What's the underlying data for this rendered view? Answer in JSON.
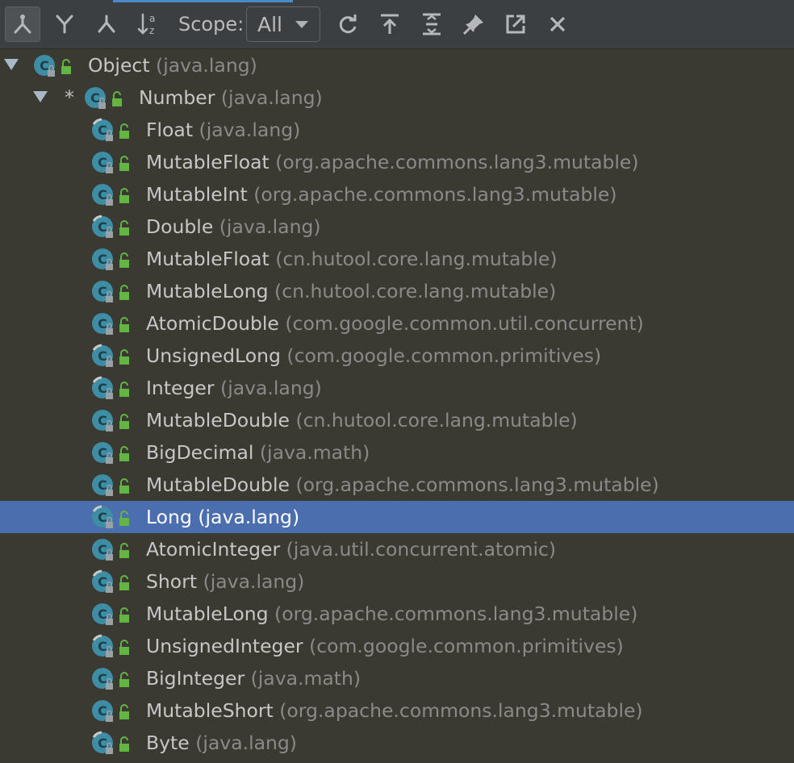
{
  "toolbar": {
    "buttons": [
      {
        "icon": "supertypes-hierarchy-icon",
        "active": true
      },
      {
        "icon": "subtypes-hierarchy-icon",
        "active": false
      },
      {
        "icon": "class-hierarchy-icon",
        "active": false
      },
      {
        "icon": "sort-alphabetically-icon",
        "active": false
      }
    ],
    "scope_label": "Scope:",
    "scope_value": "All",
    "right_buttons": [
      "refresh-icon",
      "export-icon",
      "expand-all-icon",
      "pin-icon",
      "open-in-window-icon",
      "close-icon"
    ]
  },
  "tree": {
    "rows": [
      {
        "name": "Object",
        "pkg": "(java.lang)",
        "level": 0,
        "expanded": true
      },
      {
        "name": "Number",
        "pkg": "(java.lang)",
        "level": 1,
        "expanded": true,
        "star": "*"
      },
      {
        "name": "Float",
        "pkg": "(java.lang)",
        "level": 2,
        "final": true
      },
      {
        "name": "MutableFloat",
        "pkg": "(org.apache.commons.lang3.mutable)",
        "level": 2
      },
      {
        "name": "MutableInt",
        "pkg": "(org.apache.commons.lang3.mutable)",
        "level": 2
      },
      {
        "name": "Double",
        "pkg": "(java.lang)",
        "level": 2,
        "final": true
      },
      {
        "name": "MutableFloat",
        "pkg": "(cn.hutool.core.lang.mutable)",
        "level": 2
      },
      {
        "name": "MutableLong",
        "pkg": "(cn.hutool.core.lang.mutable)",
        "level": 2
      },
      {
        "name": "AtomicDouble",
        "pkg": "(com.google.common.util.concurrent)",
        "level": 2
      },
      {
        "name": "UnsignedLong",
        "pkg": "(com.google.common.primitives)",
        "level": 2,
        "final": true
      },
      {
        "name": "Integer",
        "pkg": "(java.lang)",
        "level": 2,
        "final": true
      },
      {
        "name": "MutableDouble",
        "pkg": "(cn.hutool.core.lang.mutable)",
        "level": 2
      },
      {
        "name": "BigDecimal",
        "pkg": "(java.math)",
        "level": 2
      },
      {
        "name": "MutableDouble",
        "pkg": "(org.apache.commons.lang3.mutable)",
        "level": 2
      },
      {
        "name": "Long",
        "pkg": "(java.lang)",
        "level": 2,
        "final": true,
        "selected": true
      },
      {
        "name": "AtomicInteger",
        "pkg": "(java.util.concurrent.atomic)",
        "level": 2
      },
      {
        "name": "Short",
        "pkg": "(java.lang)",
        "level": 2,
        "final": true
      },
      {
        "name": "MutableLong",
        "pkg": "(org.apache.commons.lang3.mutable)",
        "level": 2
      },
      {
        "name": "UnsignedInteger",
        "pkg": "(com.google.common.primitives)",
        "level": 2,
        "final": true
      },
      {
        "name": "BigInteger",
        "pkg": "(java.math)",
        "level": 2
      },
      {
        "name": "MutableShort",
        "pkg": "(org.apache.commons.lang3.mutable)",
        "level": 2
      },
      {
        "name": "Byte",
        "pkg": "(java.lang)",
        "level": 2,
        "final": true
      }
    ]
  },
  "colors": {
    "toolbar_bg": "#3c3f41",
    "tree_bg": "#3b3a32",
    "selection": "#4b6eaf",
    "class_icon": "#3d8da4",
    "lock_icon": "#62b543"
  }
}
